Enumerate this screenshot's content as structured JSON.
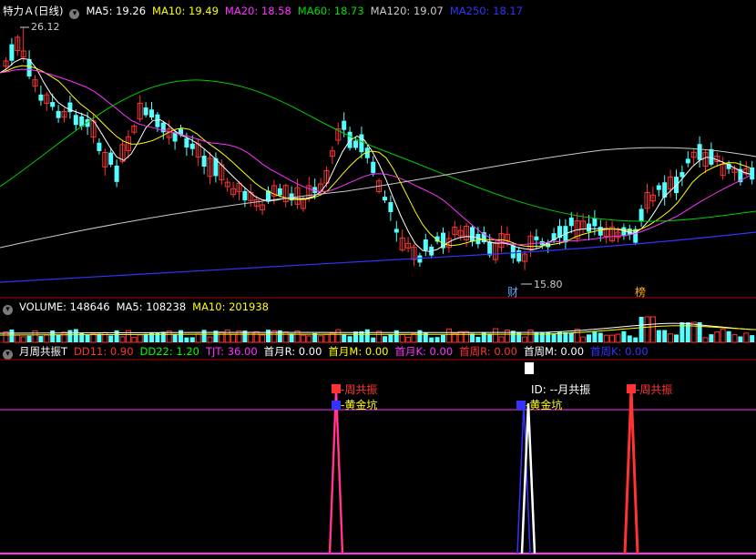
{
  "title_bar": {
    "stock": "特力Ａ",
    "period": "(日线)",
    "ma": [
      {
        "label": "MA5: 19.26",
        "color": "#ffffff"
      },
      {
        "label": "MA10: 19.49",
        "color": "#ffff00"
      },
      {
        "label": "MA20: 18.58",
        "color": "#ff33ff"
      },
      {
        "label": "MA60: 18.73",
        "color": "#00dd00"
      },
      {
        "label": "MA120: 19.07",
        "color": "#cccccc"
      },
      {
        "label": "MA250: 18.17",
        "color": "#3333ff"
      }
    ]
  },
  "price_panel": {
    "high_label": "26.12",
    "low_label": "15.80",
    "event_labels": [
      {
        "text": "财",
        "color": "#66a3ff"
      },
      {
        "text": "榜",
        "color": "#ffb000"
      }
    ]
  },
  "volume_bar": {
    "items": [
      {
        "label": "VOLUME: 148646",
        "color": "#ffffff"
      },
      {
        "label": "MA5: 108238",
        "color": "#ffffff"
      },
      {
        "label": "MA10: 201938",
        "color": "#ffff00"
      }
    ]
  },
  "indicator_bar": {
    "name": "月周共振T",
    "items": [
      {
        "label": "DD11: 0.90",
        "color": "#ff3333"
      },
      {
        "label": "DD22: 1.20",
        "color": "#00ff00"
      },
      {
        "label": "TJT: 36.00",
        "color": "#ff33ff"
      },
      {
        "label": "首月R: 0.00",
        "color": "#ffffff"
      },
      {
        "label": "首月M: 0.00",
        "color": "#ffff00"
      },
      {
        "label": "首月K: 0.00",
        "color": "#ff33ff"
      },
      {
        "label": "首周R: 0.00",
        "color": "#ff3333"
      },
      {
        "label": "首周M: 0.00",
        "color": "#ffffff"
      },
      {
        "label": "首周K: 0.00",
        "color": "#3333ff"
      }
    ]
  },
  "indicator_panel": {
    "signals": [
      {
        "text": "-周共振",
        "color": "#ff3333"
      },
      {
        "text": "-黄金坑",
        "color": "#ffff00"
      },
      {
        "text": "ID: --月共振",
        "color": "#ffffff"
      },
      {
        "text": "-黄金坑",
        "color": "#ffff00"
      },
      {
        "text": "-周共振",
        "color": "#ff3333"
      }
    ]
  },
  "colors": {
    "up": "#ff3333",
    "down": "#54ffff",
    "frame": "#b00000"
  }
}
